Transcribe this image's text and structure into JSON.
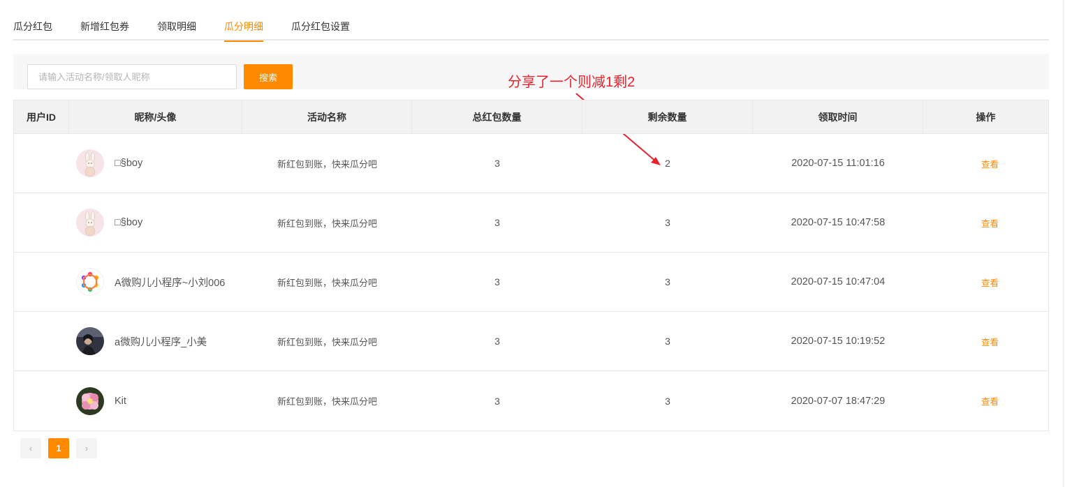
{
  "tabs": [
    {
      "label": "瓜分红包",
      "active": false
    },
    {
      "label": "新增红包券",
      "active": false
    },
    {
      "label": "领取明细",
      "active": false
    },
    {
      "label": "瓜分明细",
      "active": true
    },
    {
      "label": "瓜分红包设置",
      "active": false
    }
  ],
  "search": {
    "placeholder": "请输入活动名称/领取人昵称",
    "value": "",
    "button_label": "搜索"
  },
  "annotation": {
    "text": "分享了一个则减1剩2",
    "color": "#e9212c"
  },
  "table": {
    "headers": [
      "用户ID",
      "昵称/头像",
      "活动名称",
      "总红包数量",
      "剩余数量",
      "领取时间",
      "操作"
    ],
    "rows": [
      {
        "user_id": "",
        "avatar": "bunny-avatar",
        "nickname": "□§boy",
        "activity": "新红包到账，快来瓜分吧",
        "total": "3",
        "remaining": "2",
        "time": "2020-07-15 11:01:16",
        "action": "查看"
      },
      {
        "user_id": "",
        "avatar": "bunny-avatar",
        "nickname": "□§boy",
        "activity": "新红包到账，快来瓜分吧",
        "total": "3",
        "remaining": "3",
        "time": "2020-07-15 10:47:58",
        "action": "查看"
      },
      {
        "user_id": "",
        "avatar": "colorful-logo-avatar",
        "nickname": "A微购儿小程序~小刘006",
        "activity": "新红包到账，快来瓜分吧",
        "total": "3",
        "remaining": "3",
        "time": "2020-07-15 10:47:04",
        "action": "查看"
      },
      {
        "user_id": "",
        "avatar": "portrait-avatar",
        "nickname": "a微购儿小程序_小美",
        "activity": "新红包到账，快来瓜分吧",
        "total": "3",
        "remaining": "3",
        "time": "2020-07-15 10:19:52",
        "action": "查看"
      },
      {
        "user_id": "",
        "avatar": "flower-avatar",
        "nickname": "Kit",
        "activity": "新红包到账，快来瓜分吧",
        "total": "3",
        "remaining": "3",
        "time": "2020-07-07 18:47:29",
        "action": "查看"
      }
    ]
  },
  "pagination": {
    "prev": "‹",
    "current": "1",
    "next": "›"
  },
  "colors": {
    "accent": "#ff8a00",
    "annotation": "#e9212c"
  }
}
